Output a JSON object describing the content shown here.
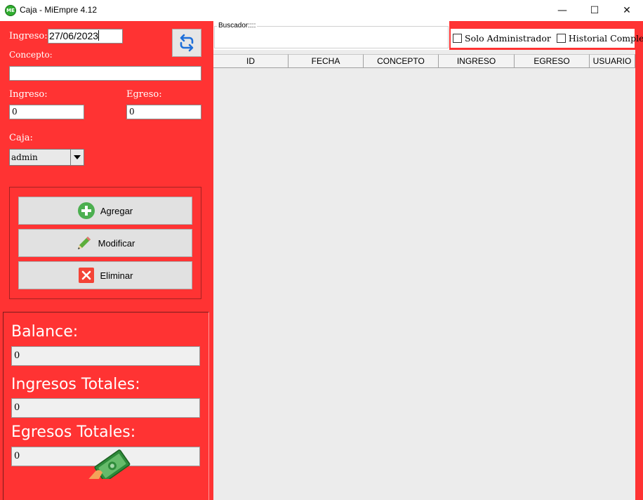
{
  "window": {
    "title": "Caja - MiEmpre 4.12",
    "app_icon_text": "ME",
    "minimize_glyph": "—",
    "maximize_glyph": "☐",
    "close_glyph": "✕"
  },
  "form": {
    "date_label": "Ingreso:",
    "date_value": "27/06/2023",
    "concept_label": "Concepto:",
    "concept_value": "",
    "income_label": "Ingreso:",
    "income_value": "0",
    "expense_label": "Egreso:",
    "expense_value": "0",
    "cashbox_label": "Caja:",
    "cashbox_value": "admin"
  },
  "actions": {
    "add_label": "Agregar",
    "edit_label": "Modificar",
    "delete_label": "Eliminar"
  },
  "summary": {
    "balance_label": "Balance:",
    "balance_value": "0",
    "income_total_label": "Ingresos Totales:",
    "income_total_value": "0",
    "expense_total_label": "Egresos Totales:",
    "expense_total_value": "0"
  },
  "search": {
    "legend": "Buscador::::",
    "value": ""
  },
  "filters": {
    "admin_only_label": "Solo Administrador",
    "admin_only_checked": false,
    "full_history_label": "Historial Completo",
    "full_history_checked": false
  },
  "grid": {
    "columns": [
      "ID",
      "FECHA",
      "CONCEPTO",
      "INGRESO",
      "EGRESO",
      "USUARIO"
    ],
    "rows": []
  },
  "colors": {
    "panel_red": "#ff3333",
    "grid_background": "#ececec",
    "add_icon": "#4caf50",
    "delete_icon": "#f44336",
    "refresh_icon": "#1e6fd9"
  },
  "icons": {
    "refresh": "refresh-icon",
    "add": "plus-circle-icon",
    "edit": "pencil-icon",
    "delete": "x-square-icon",
    "combo": "chevron-down-icon",
    "money": "money-bill-icon"
  }
}
